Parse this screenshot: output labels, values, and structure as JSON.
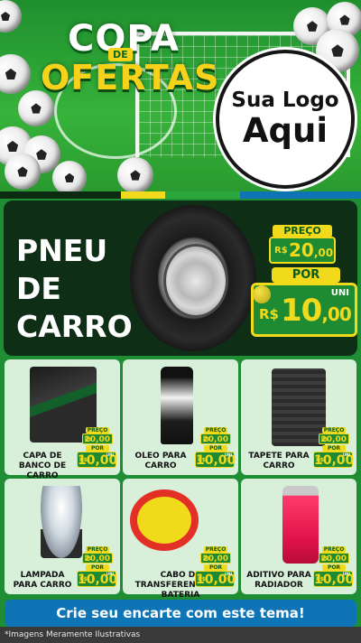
{
  "header": {
    "title_line1": "COPA",
    "title_de": "DE",
    "title_line2": "OFERTAS",
    "logo_line1": "Sua Logo",
    "logo_line2": "Aqui"
  },
  "colors": {
    "green": "#1f8d33",
    "dark_green": "#0e2e15",
    "yellow": "#f1d91c",
    "blue": "#0f74b5"
  },
  "hero": {
    "name_lines": [
      "PNEU",
      "DE",
      "CARRO"
    ],
    "preco_label": "PREÇO",
    "preco_currency": "R$",
    "preco_int": "20",
    "preco_dec": ",00",
    "por_label": "POR",
    "por_currency": "R$",
    "por_int": "10",
    "por_dec": ",00",
    "unit": "UNI"
  },
  "products": [
    {
      "name": "CAPA DE BANCO DE CARRO",
      "preco_label": "PREÇO",
      "preco": "20,00",
      "por_label": "POR",
      "por": "10,00",
      "unit": "UNI",
      "currency": "R$"
    },
    {
      "name": "OLEO PARA CARRO",
      "preco_label": "PREÇO",
      "preco": "20,00",
      "por_label": "POR",
      "por": "10,00",
      "unit": "UNI",
      "currency": "R$"
    },
    {
      "name": "TAPETE PARA CARRO",
      "preco_label": "PREÇO",
      "preco": "20,00",
      "por_label": "POR",
      "por": "10,00",
      "unit": "UNI",
      "currency": "R$"
    },
    {
      "name": "LAMPADA PARA CARRO",
      "preco_label": "PREÇO",
      "preco": "20,00",
      "por_label": "POR",
      "por": "10,00",
      "unit": "UNI",
      "currency": "R$"
    },
    {
      "name": "CABO DE TRANSFERENCIA DE BATERIA",
      "preco_label": "PREÇO",
      "preco": "20,00",
      "por_label": "POR",
      "por": "10,00",
      "unit": "UNI",
      "currency": "R$"
    },
    {
      "name": "ADITIVO PARA RADIADOR",
      "preco_label": "PREÇO",
      "preco": "20,00",
      "por_label": "POR",
      "por": "10,00",
      "unit": "UNI",
      "currency": "R$"
    }
  ],
  "cta": "Crie seu encarte com este tema!",
  "footnote": "*Imagens Meramente Ilustrativas"
}
